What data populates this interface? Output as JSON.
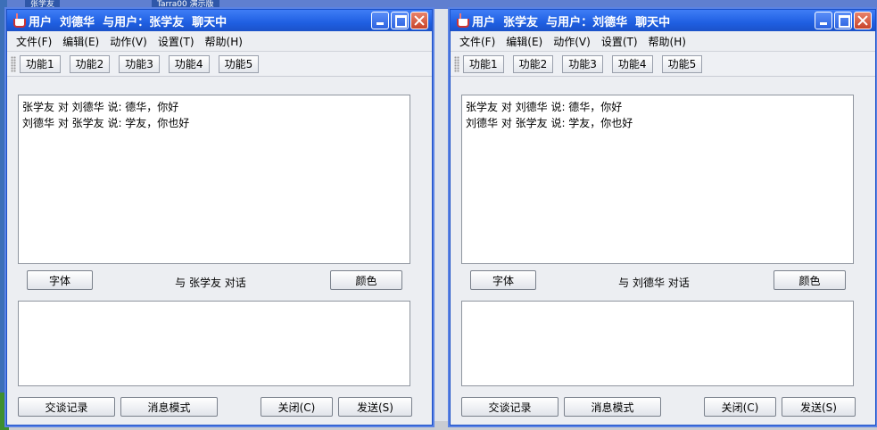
{
  "background": {
    "tab_left": "张学友",
    "tab_mid": "Tarra00 演示版"
  },
  "windows": [
    {
      "title": "用户  刘德华  与用户：张学友  聊天中",
      "menu": [
        "文件(F)",
        "编辑(E)",
        "动作(V)",
        "设置(T)",
        "帮助(H)"
      ],
      "tools": [
        "功能1",
        "功能2",
        "功能3",
        "功能4",
        "功能5"
      ],
      "messages": [
        "张学友 对 刘德华 说: 德华，你好",
        "刘德华 对 张学友 说: 学友，你也好"
      ],
      "font_label": "字体",
      "dialog_label": "与 张学友 对话",
      "color_label": "颜色",
      "history_label": "交谈记录",
      "mode_label": "消息模式",
      "close_label": "关闭(C)",
      "send_label": "发送(S)",
      "input_value": ""
    },
    {
      "title": "用户  张学友  与用户：刘德华  聊天中",
      "menu": [
        "文件(F)",
        "编辑(E)",
        "动作(V)",
        "设置(T)",
        "帮助(H)"
      ],
      "tools": [
        "功能1",
        "功能2",
        "功能3",
        "功能4",
        "功能5"
      ],
      "messages": [
        "张学友 对 刘德华 说: 德华，你好",
        "刘德华 对 张学友 说: 学友，你也好"
      ],
      "font_label": "字体",
      "dialog_label": "与 刘德华 对话",
      "color_label": "颜色",
      "history_label": "交谈记录",
      "mode_label": "消息模式",
      "close_label": "关闭(C)",
      "send_label": "发送(S)",
      "input_value": ""
    }
  ],
  "colors": {
    "titlebar": "#1f5fe2",
    "window_border": "#1a4fc7"
  }
}
